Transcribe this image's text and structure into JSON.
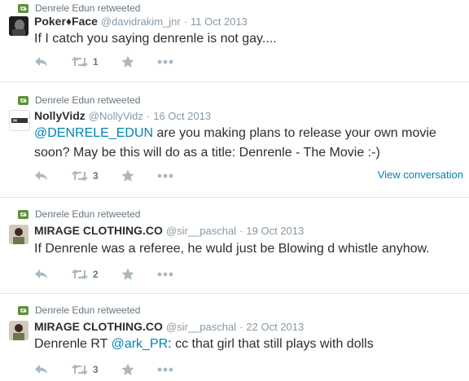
{
  "tweets": [
    {
      "retweeted_by": "Denrele Edun retweeted",
      "name": "Poker♦Face",
      "handle": "@davidrakim_jnr",
      "date": "11 Oct 2013",
      "text_parts": [
        "If I catch you saying denrenle is not gay...."
      ],
      "retweet_count": "1",
      "view_conversation": ""
    },
    {
      "retweeted_by": "Denrele Edun retweeted",
      "name": "NollyVidz",
      "handle": "@NollyVidz",
      "date": "16 Oct 2013",
      "mention": "@DENRELE_EDUN",
      "text_parts": [
        " are you making plans to release your own movie",
        "soon? May be this will do as a title: Denrenle -  The Movie :-)"
      ],
      "retweet_count": "3",
      "view_conversation": "View conversation"
    },
    {
      "retweeted_by": "Denrele Edun retweeted",
      "name": "MIRAGE CLOTHING.CO",
      "handle": "@sir__paschal",
      "date": "19 Oct 2013",
      "text_parts": [
        "If Denrenle was a referee, he wuld just be Blowing d whistle anyhow."
      ],
      "retweet_count": "2",
      "view_conversation": ""
    },
    {
      "retweeted_by": "Denrele Edun retweeted",
      "name": "MIRAGE CLOTHING.CO",
      "handle": "@sir__paschal",
      "date": "22 Oct 2013",
      "text_before": "Denrenle RT ",
      "mention": "@ark_PR",
      "text_after": ": cc that girl that still plays with dolls",
      "retweet_count": "3",
      "view_conversation": ""
    }
  ],
  "separator": "·",
  "icons": {
    "retweeted": "retweet-small-icon",
    "reply": "reply-icon",
    "retweet": "retweet-icon",
    "favorite": "star-icon",
    "more": "more-dots-icon"
  },
  "colors": {
    "retweet_green": "#5c913b",
    "link_blue": "#0084b4",
    "muted": "#8899a6"
  }
}
